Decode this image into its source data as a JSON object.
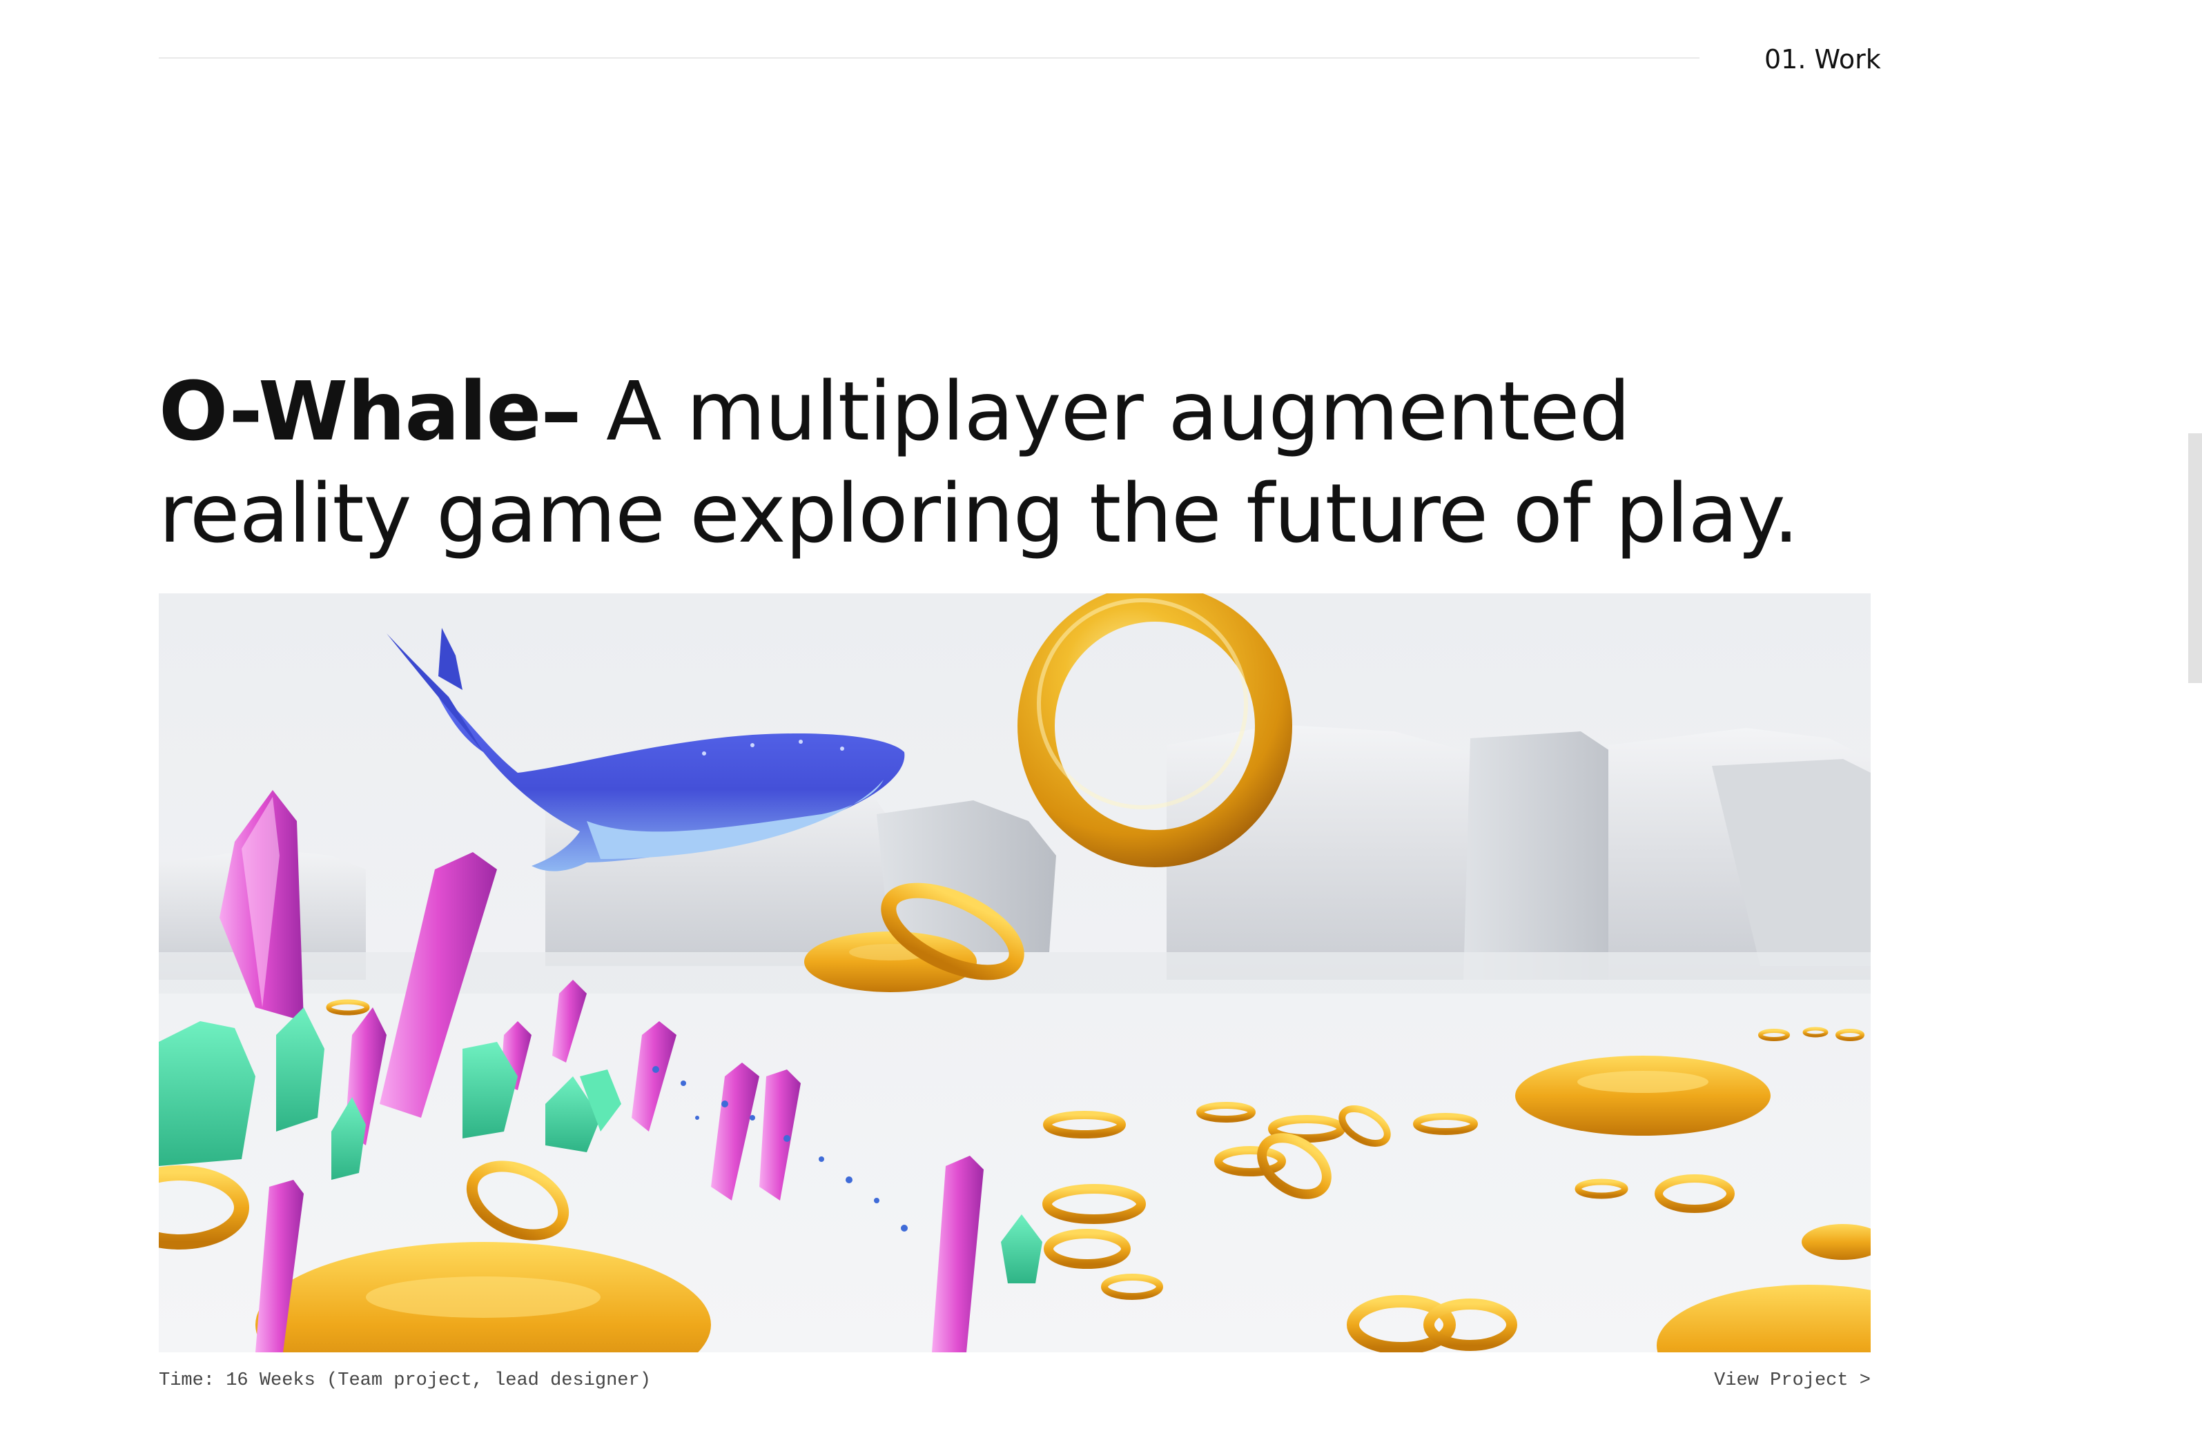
{
  "header": {
    "nav_label": "01. Work"
  },
  "project": {
    "title_bold": "O-Whale–",
    "title_rest": "A multiplayer augmented reality game exploring the future of play.",
    "hero_image": {
      "icons": [
        "whale-icon",
        "gold-ring-icon",
        "crystal-icon"
      ]
    },
    "time_label": "Time: 16 Weeks (Team project, lead designer)",
    "cta_label": "View Project >"
  },
  "colors": {
    "background": "#ffffff",
    "text": "#111111",
    "caption": "#444444",
    "gold": "#e9a419",
    "whale": "#4f5fe0",
    "crystal": "#e14fd0",
    "plant": "#3fd29b"
  }
}
